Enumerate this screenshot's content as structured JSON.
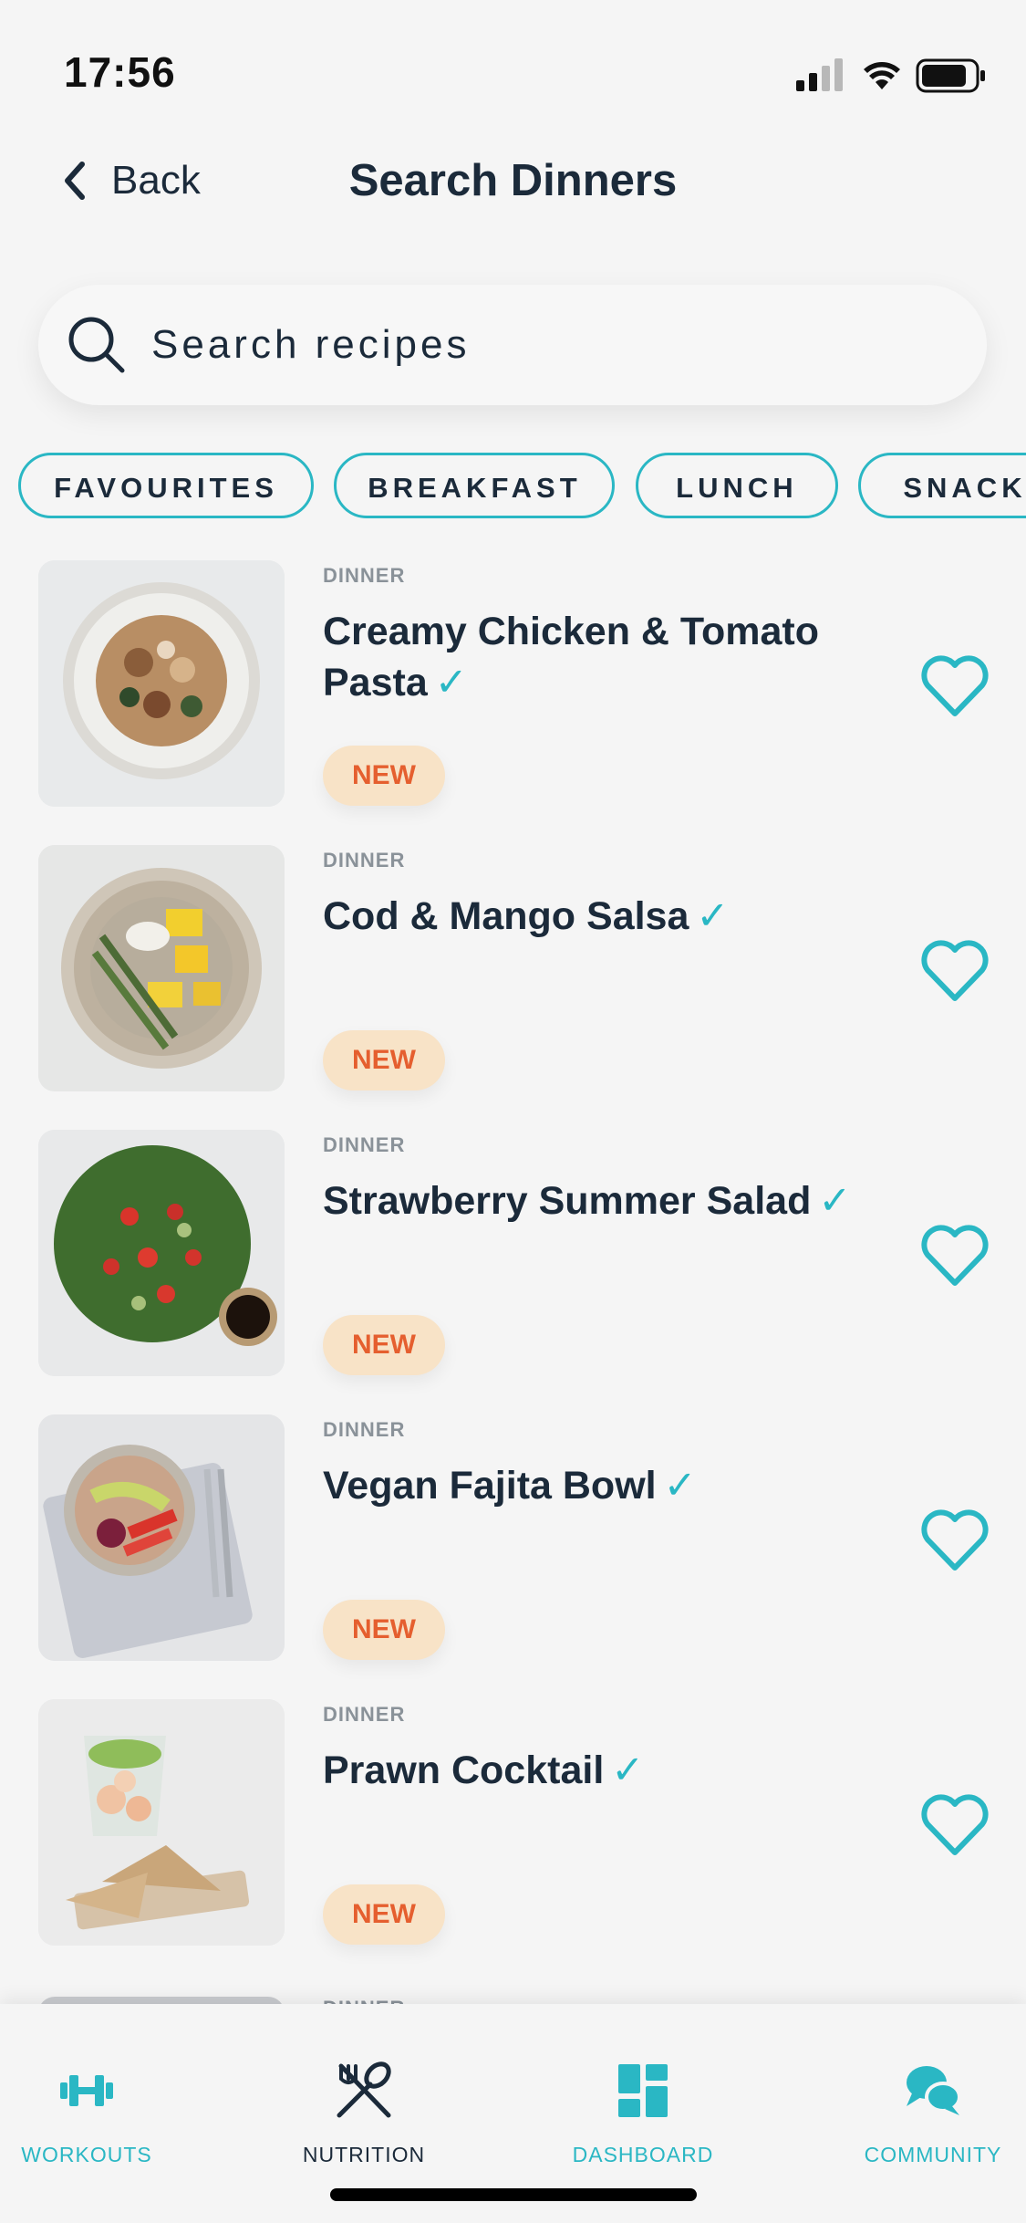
{
  "status_bar": {
    "time": "17:56"
  },
  "header": {
    "back_label": "Back",
    "title": "Search Dinners"
  },
  "search": {
    "placeholder": "Search recipes"
  },
  "filters": [
    "FAVOURITES",
    "BREAKFAST",
    "LUNCH",
    "SNACK"
  ],
  "recipes": [
    {
      "category": "DINNER",
      "title": "Creamy Chicken & Tomato Pasta",
      "badge": "NEW",
      "image": "creamy-chicken-pasta-photo"
    },
    {
      "category": "DINNER",
      "title": "Cod & Mango Salsa",
      "badge": "NEW",
      "image": "cod-mango-salsa-photo"
    },
    {
      "category": "DINNER",
      "title": "Strawberry Summer Salad",
      "badge": "NEW",
      "image": "strawberry-salad-photo"
    },
    {
      "category": "DINNER",
      "title": "Vegan Fajita Bowl",
      "badge": "NEW",
      "image": "vegan-fajita-bowl-photo"
    },
    {
      "category": "DINNER",
      "title": "Prawn Cocktail",
      "badge": "NEW",
      "image": "prawn-cocktail-photo"
    }
  ],
  "partial_row": {
    "category": "DINNER"
  },
  "tabs": [
    {
      "label": "WORKOUTS",
      "icon": "dumbbell-icon",
      "active": false
    },
    {
      "label": "NUTRITION",
      "icon": "fork-spoon-icon",
      "active": true
    },
    {
      "label": "DASHBOARD",
      "icon": "dashboard-grid-icon",
      "active": false
    },
    {
      "label": "COMMUNITY",
      "icon": "chat-bubbles-icon",
      "active": false
    }
  ],
  "colors": {
    "accent": "#2ab7c4",
    "text": "#1b2a3a",
    "badge_bg": "#f8e3c7",
    "badge_text": "#e55f2f",
    "background": "#f5f5f5"
  }
}
